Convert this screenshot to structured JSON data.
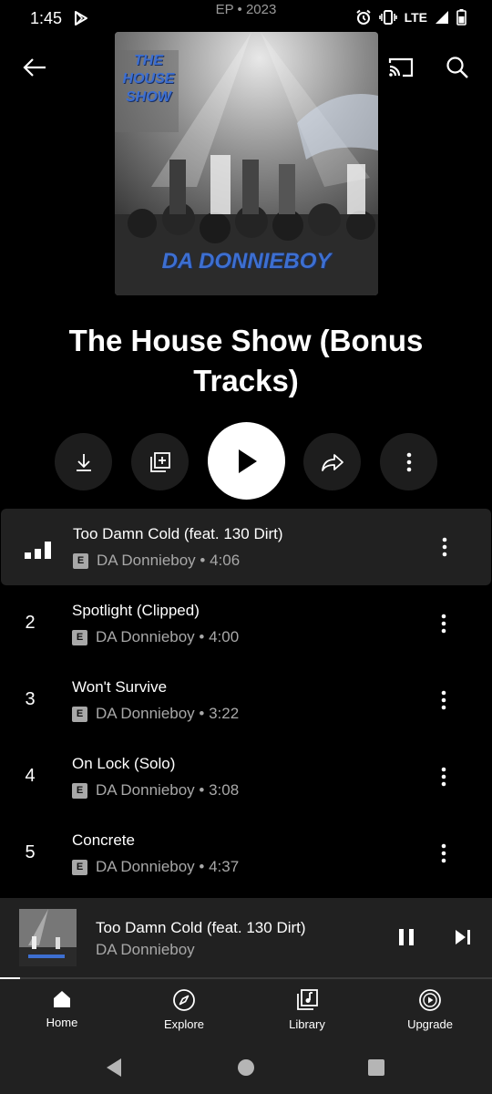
{
  "status": {
    "time": "1:45",
    "network": "LTE"
  },
  "header": {
    "ep_label": "EP • 2023"
  },
  "album": {
    "title": "The House Show (Bonus Tracks)",
    "art_text_top": "THE HOUSE SHOW",
    "art_text_bottom": "DA DONNIEBOY"
  },
  "tracks": [
    {
      "number": "",
      "title": "Too Damn Cold (feat. 130 Dirt)",
      "artist": "DA Donnieboy",
      "duration": "4:06",
      "playing": true
    },
    {
      "number": "2",
      "title": "Spotlight (Clipped)",
      "artist": "DA Donnieboy",
      "duration": "4:00"
    },
    {
      "number": "3",
      "title": "Won't Survive",
      "artist": "DA Donnieboy",
      "duration": "3:22"
    },
    {
      "number": "4",
      "title": "On Lock (Solo)",
      "artist": "DA Donnieboy",
      "duration": "3:08"
    },
    {
      "number": "5",
      "title": "Concrete",
      "artist": "DA Donnieboy",
      "duration": "4:37"
    }
  ],
  "track_sub": [
    "DA Donnieboy • 4:06",
    "DA Donnieboy • 4:00",
    "DA Donnieboy • 3:22",
    "DA Donnieboy • 3:08",
    "DA Donnieboy • 4:37"
  ],
  "explicit_badge": "E",
  "mini_player": {
    "title": "Too Damn Cold (feat. 130 Dirt)",
    "artist": "DA Donnieboy",
    "progress": 0.04
  },
  "nav": {
    "home": "Home",
    "explore": "Explore",
    "library": "Library",
    "upgrade": "Upgrade"
  },
  "colors": {
    "background": "#000000",
    "surface": "#212121",
    "secondary_text": "#a8a8a8",
    "art_text": "#3d6fd1"
  }
}
